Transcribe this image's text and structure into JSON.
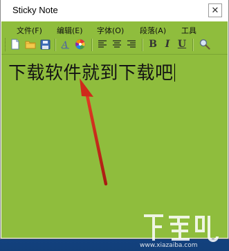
{
  "window": {
    "title": "Sticky Note",
    "close_glyph": "✕"
  },
  "menu": {
    "items": [
      {
        "label": "文件(F)"
      },
      {
        "label": "编辑(E)"
      },
      {
        "label": "字体(O)"
      },
      {
        "label": "段落(A)"
      },
      {
        "label": "工具"
      }
    ]
  },
  "toolbar": {
    "buttons": [
      {
        "icon": "new-document-icon"
      },
      {
        "icon": "open-folder-icon"
      },
      {
        "icon": "save-icon"
      },
      {
        "icon": "font-icon"
      },
      {
        "icon": "color-wheel-icon"
      },
      {
        "icon": "align-left-icon"
      },
      {
        "icon": "align-center-icon"
      },
      {
        "icon": "align-right-icon"
      },
      {
        "icon": "bold-icon",
        "label": "B"
      },
      {
        "icon": "italic-icon",
        "label": "I"
      },
      {
        "icon": "underline-icon",
        "label": "U"
      },
      {
        "icon": "find-icon"
      }
    ]
  },
  "note": {
    "text": "下载软件就到下载吧",
    "background": "#8fbd3d"
  },
  "colors": {
    "note_green": "#8fbd3d",
    "arrow_red": "#d3261b",
    "desktop_blue": "#1e5aa6"
  },
  "watermark": {
    "text": "下载吧",
    "url": "www.xiazaiba.com"
  }
}
